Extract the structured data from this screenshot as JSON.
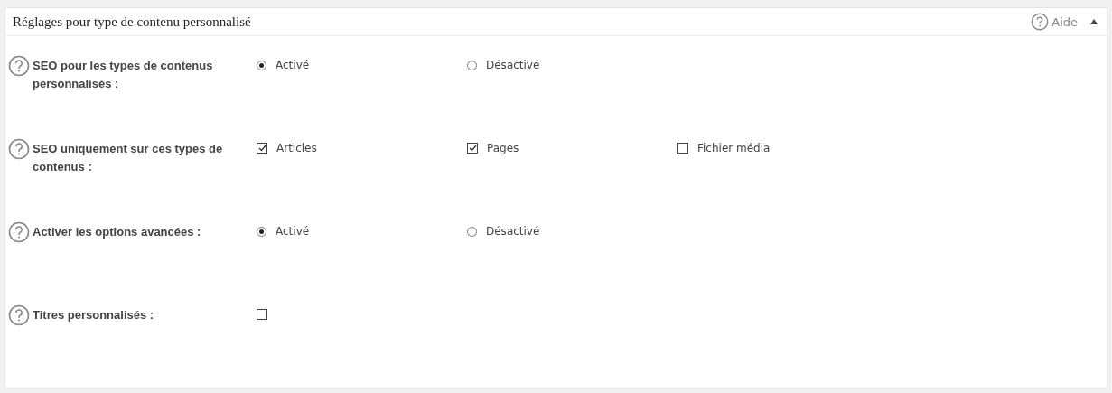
{
  "panel": {
    "title": "Réglages pour type de contenu personnalisé",
    "help_label": "Aide",
    "expanded": true
  },
  "settings": [
    {
      "label": "SEO pour les types de contenus personnalisés :",
      "options": [
        {
          "kind": "radio",
          "label": "Activé",
          "selected": true
        },
        {
          "kind": "radio",
          "label": "Désactivé",
          "selected": false
        }
      ]
    },
    {
      "label": "SEO uniquement sur ces types de contenus :",
      "options": [
        {
          "kind": "checkbox",
          "label": "Articles",
          "checked": true
        },
        {
          "kind": "checkbox",
          "label": "Pages",
          "checked": true
        },
        {
          "kind": "checkbox",
          "label": "Fichier média",
          "checked": false
        }
      ]
    },
    {
      "label": "Activer les options avancées :",
      "options": [
        {
          "kind": "radio",
          "label": "Activé",
          "selected": true
        },
        {
          "kind": "radio",
          "label": "Désactivé",
          "selected": false
        }
      ]
    },
    {
      "label": "Titres personnalisés :",
      "options": [
        {
          "kind": "checkbox",
          "checked": false
        }
      ]
    }
  ]
}
